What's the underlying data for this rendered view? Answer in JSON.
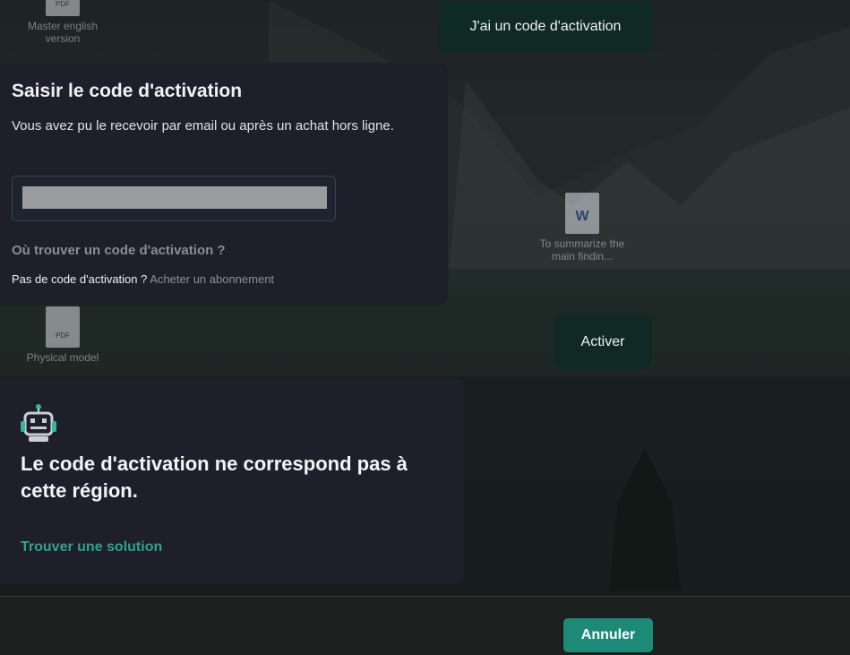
{
  "background": {
    "desktop_icons": [
      {
        "caption": "Master english version",
        "tag": "PDF"
      },
      {
        "caption": "To summarize the main findin...",
        "tag": "W"
      },
      {
        "caption": "Physical model",
        "tag": "PDF"
      }
    ]
  },
  "header": {
    "activation_code_button": "J'ai un code d'activation"
  },
  "entry_panel": {
    "title": "Saisir le code d'activation",
    "description": "Vous avez pu le recevoir par email ou après un achat hors ligne.",
    "code_value": "",
    "where_link": "Où trouver un code d'activation ?",
    "no_code_text": "Pas de code d'activation ?",
    "buy_link": "Acheter un abonnement"
  },
  "activate_button": "Activer",
  "error_panel": {
    "icon": "robot-icon",
    "message": "Le code d'activation ne correspond pas à cette région.",
    "solution_link": "Trouver une solution"
  },
  "footer": {
    "cancel_button": "Annuler"
  },
  "colors": {
    "panel": "#1f1e2b",
    "accent": "#1c8a77",
    "link_teal": "#2aa58f",
    "dark_button": "#0f2a25"
  }
}
